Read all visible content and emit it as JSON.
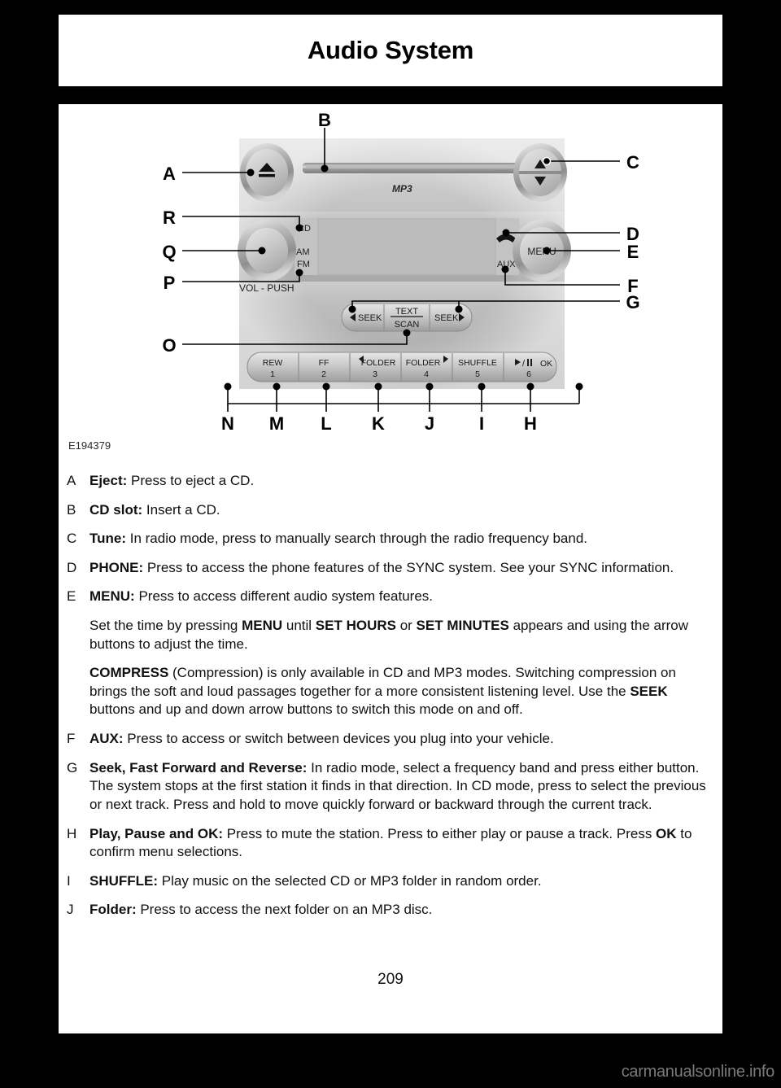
{
  "header": {
    "title": "Audio System"
  },
  "figure": {
    "code": "E194379",
    "faceplate": {
      "mp3_label": "MP3",
      "source_labels": [
        "CD",
        "AM",
        "FM"
      ],
      "volume_label": "VOL - PUSH",
      "aux_label": "AUX",
      "menu_label": "MENU",
      "seek_left_label": "SEEK",
      "seek_right_label": "SEEK",
      "text_label": "TEXT",
      "scan_label": "SCAN",
      "presets": [
        {
          "name": "REW",
          "number": "1"
        },
        {
          "name": "FF",
          "number": "2"
        },
        {
          "name": "FOLDER",
          "number": "3",
          "arrow": "left"
        },
        {
          "name": "FOLDER",
          "number": "4",
          "arrow": "right"
        },
        {
          "name": "SHUFFLE",
          "number": "5"
        },
        {
          "name": "OK",
          "number": "6",
          "glyph": "play-pause"
        }
      ]
    },
    "callouts": [
      "A",
      "B",
      "C",
      "D",
      "E",
      "F",
      "G",
      "H",
      "I",
      "J",
      "K",
      "L",
      "M",
      "N",
      "O",
      "P",
      "Q",
      "R"
    ]
  },
  "items": [
    {
      "letter": "A",
      "html": "<b>Eject:</b> Press to eject a CD."
    },
    {
      "letter": "B",
      "html": "<b>CD slot:</b> Insert a CD."
    },
    {
      "letter": "C",
      "html": "<b>Tune:</b> In radio mode, press to manually search through the radio frequency band."
    },
    {
      "letter": "D",
      "html": "<b>PHONE:</b> Press to access the phone features of the SYNC system. See your SYNC information."
    },
    {
      "letter": "E",
      "html": "<b>MENU:</b> Press to access different audio system features.",
      "paragraphs": [
        "Set the time by pressing <b>MENU</b> until <b>SET HOURS</b> or <b>SET MINUTES</b> appears and using the arrow buttons to adjust the time.",
        "<b>COMPRESS</b> (Compression) is only available in CD and MP3 modes. Switching compression on brings the soft and loud passages together for a more consistent listening level. Use the <b>SEEK</b> buttons and up and down arrow buttons to switch this mode on and off."
      ]
    },
    {
      "letter": "F",
      "html": "<b>AUX:</b> Press to access or switch between devices you plug into your vehicle."
    },
    {
      "letter": "G",
      "html": "<b>Seek, Fast Forward and Reverse:</b> In radio mode, select a frequency band and press either button. The system stops at the first station it finds in that direction. In CD mode, press to select the previous or next track. Press and hold to move quickly forward or backward through the current track."
    },
    {
      "letter": "H",
      "html": "<b>Play, Pause and OK:</b> Press to mute the station. Press to either play or pause a track. Press <b>OK</b> to confirm menu selections."
    },
    {
      "letter": "I",
      "html": "<b>SHUFFLE:</b> Play music on the selected CD or MP3 folder in random order."
    },
    {
      "letter": "J",
      "html": "<b>Folder:</b> Press to access the next folder on an MP3 disc."
    }
  ],
  "footer": {
    "page_number": "209",
    "watermark": "carmanualsonline.info"
  }
}
